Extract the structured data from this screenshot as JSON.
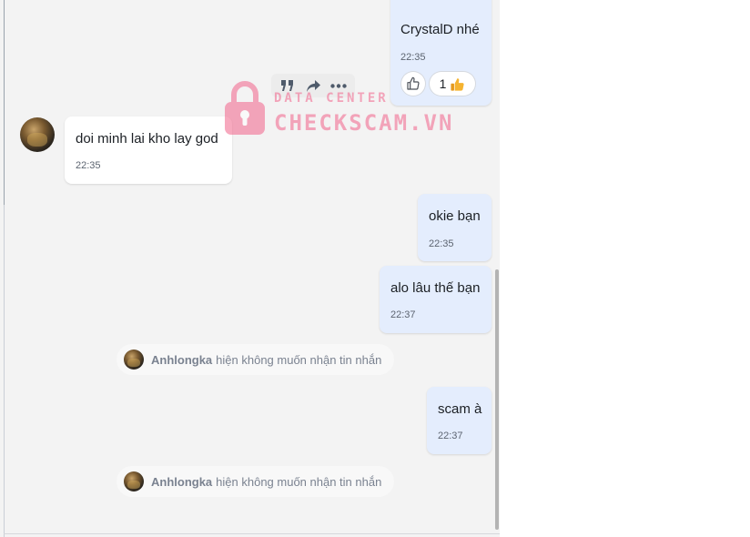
{
  "messages": {
    "m1": {
      "text": "CrystalD nhé",
      "time": "22:35",
      "reaction_count": "1"
    },
    "m2": {
      "text": "doi minh lai kho lay god",
      "time": "22:35"
    },
    "m3": {
      "text": "okie bạn",
      "time": "22:35"
    },
    "m4": {
      "text": "alo lâu thế bạn",
      "time": "22:37"
    },
    "m5": {
      "text": "scam à",
      "time": "22:37"
    }
  },
  "system_notices": [
    {
      "name": "Anhlongka",
      "text": "hiện không muốn nhận tin nhắn"
    },
    {
      "name": "Anhlongka",
      "text": "hiện không muốn nhận tin nhắn"
    }
  ],
  "watermark": {
    "line1": "DATA CENTER",
    "line2": "CHECKSCAM.VN"
  },
  "icons": {
    "quote": "quote-icon",
    "forward": "forward-icon",
    "more": "more-icon",
    "like": "thumbs-up-outline-icon",
    "reaction": "thumbs-up-emoji-icon"
  },
  "colors": {
    "outgoing_bubble": "#e4edfd",
    "incoming_bubble": "#ffffff",
    "chat_background": "#f3f3f3",
    "watermark": "#f2638a"
  }
}
